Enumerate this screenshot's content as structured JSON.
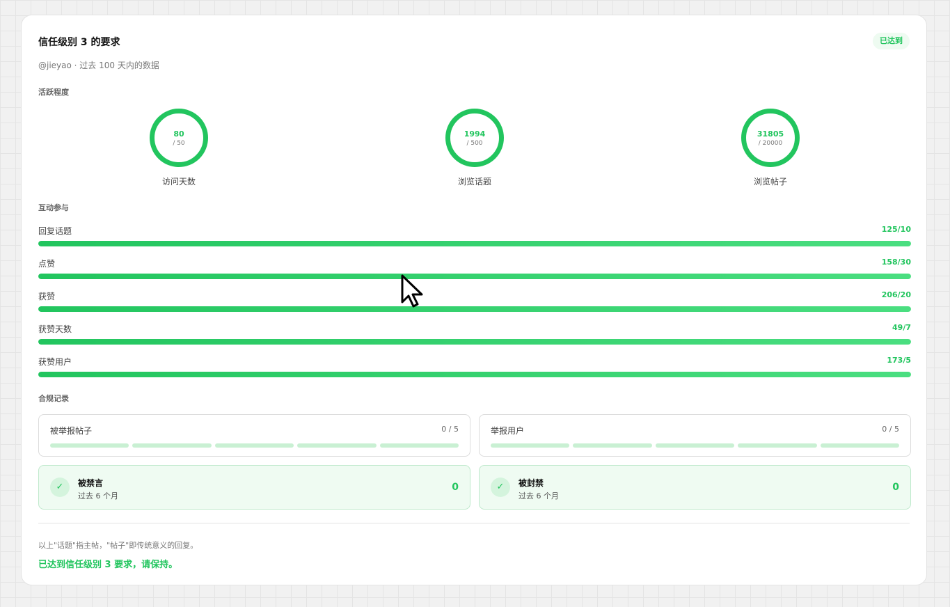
{
  "header": {
    "title": "信任级别 3 的要求",
    "badge": "已达到",
    "subtitle": "@jieyao · 过去 100 天内的数据"
  },
  "activity": {
    "label": "活跃程度",
    "rings": [
      {
        "value": "80",
        "target": "/ 50",
        "label": "访问天数"
      },
      {
        "value": "1994",
        "target": "/ 500",
        "label": "浏览话题"
      },
      {
        "value": "31805",
        "target": "/ 20000",
        "label": "浏览帖子"
      }
    ]
  },
  "interaction": {
    "label": "互动参与",
    "bars": [
      {
        "label": "回复话题",
        "count": "125/10",
        "progress": 1.0
      },
      {
        "label": "点赞",
        "count": "158/30",
        "progress": 1.0
      },
      {
        "label": "获赞",
        "count": "206/20",
        "progress": 1.0
      },
      {
        "label": "获赞天数",
        "count": "49/7",
        "progress": 1.0
      },
      {
        "label": "获赞用户",
        "count": "173/5",
        "progress": 1.0
      }
    ]
  },
  "compliance": {
    "label": "合规记录",
    "reports": [
      {
        "label": "被举报帖子",
        "count": "0 / 5"
      },
      {
        "label": "举报用户",
        "count": "0 / 5"
      }
    ],
    "statuses": [
      {
        "title": "被禁言",
        "sub": "过去 6 个月",
        "value": "0"
      },
      {
        "title": "被封禁",
        "sub": "过去 6 个月",
        "value": "0"
      }
    ]
  },
  "footer": {
    "note": "以上\"话题\"指主帖，\"帖子\"即传统意义的回复。",
    "conclusion": "已达到信任级别 3 要求，请保持。"
  },
  "icons": {
    "check": "check-icon",
    "cursor": "mouse-pointer-icon"
  },
  "colors": {
    "accent": "#22c55e",
    "accent_light": "#4ade80",
    "success_bg": "#effbf2"
  }
}
